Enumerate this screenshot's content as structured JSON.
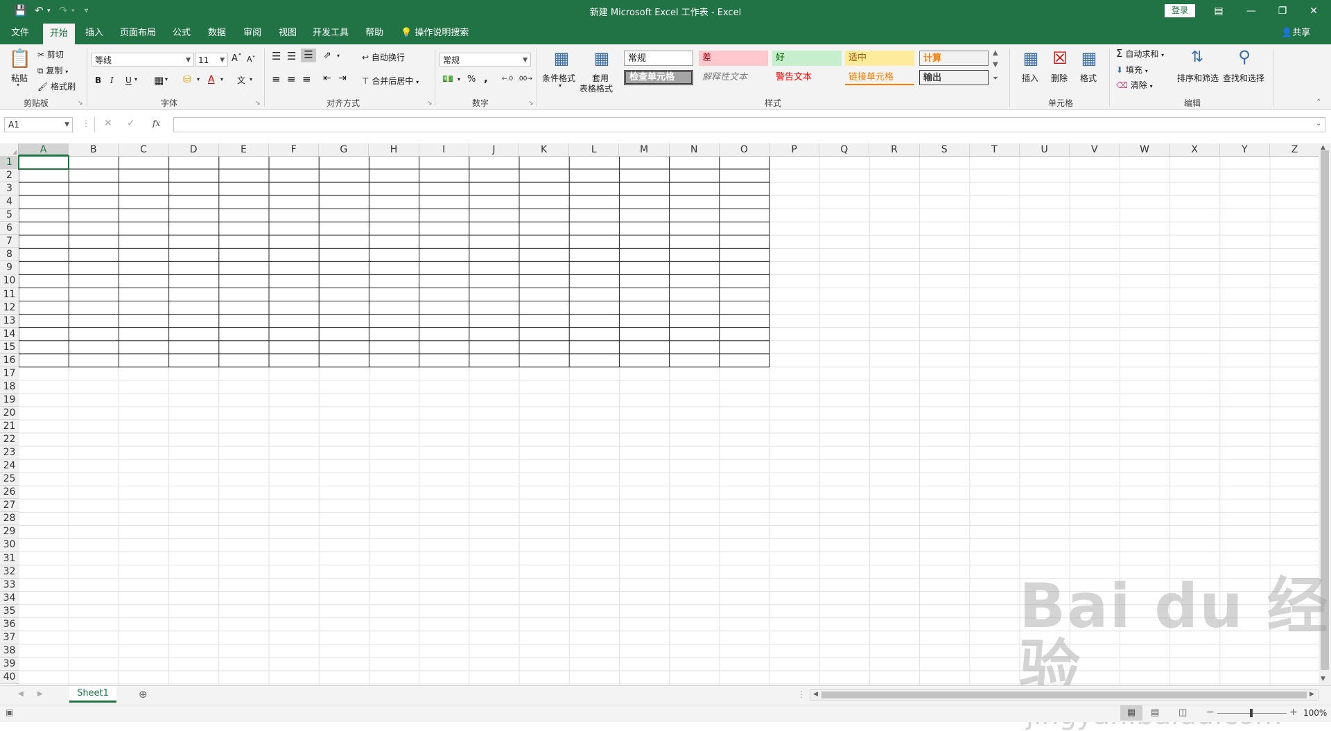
{
  "app": {
    "title": "新建 Microsoft Excel 工作表  -  Excel",
    "login": "登录",
    "share": "共享",
    "accent": "#217346"
  },
  "tabs": [
    "文件",
    "开始",
    "插入",
    "页面布局",
    "公式",
    "数据",
    "审阅",
    "视图",
    "开发工具",
    "帮助"
  ],
  "tell_me": "操作说明搜索",
  "ribbon": {
    "clipboard": {
      "label": "剪贴板",
      "paste": "粘贴",
      "cut": "剪切",
      "copy": "复制",
      "format_painter": "格式刷"
    },
    "font": {
      "label": "字体",
      "name": "等线",
      "size": "11",
      "bold": "B",
      "italic": "I",
      "underline": "U"
    },
    "alignment": {
      "label": "对齐方式",
      "wrap": "自动换行",
      "merge": "合并后居中"
    },
    "number": {
      "label": "数字",
      "format": "常规",
      "percent": "%",
      "comma": ","
    },
    "styles": {
      "label": "样式",
      "conditional": "条件格式",
      "as_table_line1": "套用",
      "as_table_line2": "表格格式",
      "cells": [
        "常规",
        "差",
        "好",
        "适中",
        "计算",
        "检查单元格",
        "解释性文本",
        "警告文本",
        "链接单元格",
        "输出"
      ]
    },
    "cells": {
      "label": "单元格",
      "insert": "插入",
      "delete": "删除",
      "format": "格式"
    },
    "editing": {
      "label": "编辑",
      "autosum": "自动求和",
      "fill": "填充",
      "clear": "清除",
      "sort_filter": "排序和筛选",
      "find_select": "查找和选择"
    }
  },
  "formula_bar": {
    "name_box": "A1",
    "fx": "fx",
    "value": ""
  },
  "grid": {
    "columns": [
      "A",
      "B",
      "C",
      "D",
      "E",
      "F",
      "G",
      "H",
      "I",
      "J",
      "K",
      "L",
      "M",
      "N",
      "O",
      "P",
      "Q",
      "R",
      "S",
      "T",
      "U",
      "V",
      "W",
      "X",
      "Y",
      "Z"
    ],
    "rows": [
      "1",
      "2",
      "3",
      "4",
      "5",
      "6",
      "7",
      "8",
      "9",
      "10",
      "11",
      "12",
      "13",
      "14",
      "15",
      "16",
      "17",
      "18",
      "19",
      "20",
      "21",
      "22",
      "23",
      "24",
      "25",
      "26",
      "27",
      "28",
      "29",
      "30",
      "31",
      "32",
      "33",
      "34",
      "35",
      "36",
      "37",
      "38",
      "39",
      "40"
    ],
    "selected_cell": "A1",
    "bordered_range": "A1:O16"
  },
  "sheets": [
    "Sheet1"
  ],
  "status": {
    "zoom": "100%"
  },
  "watermark": {
    "logo": "Bai du 经验",
    "url": "jingyan.baidu.com"
  }
}
